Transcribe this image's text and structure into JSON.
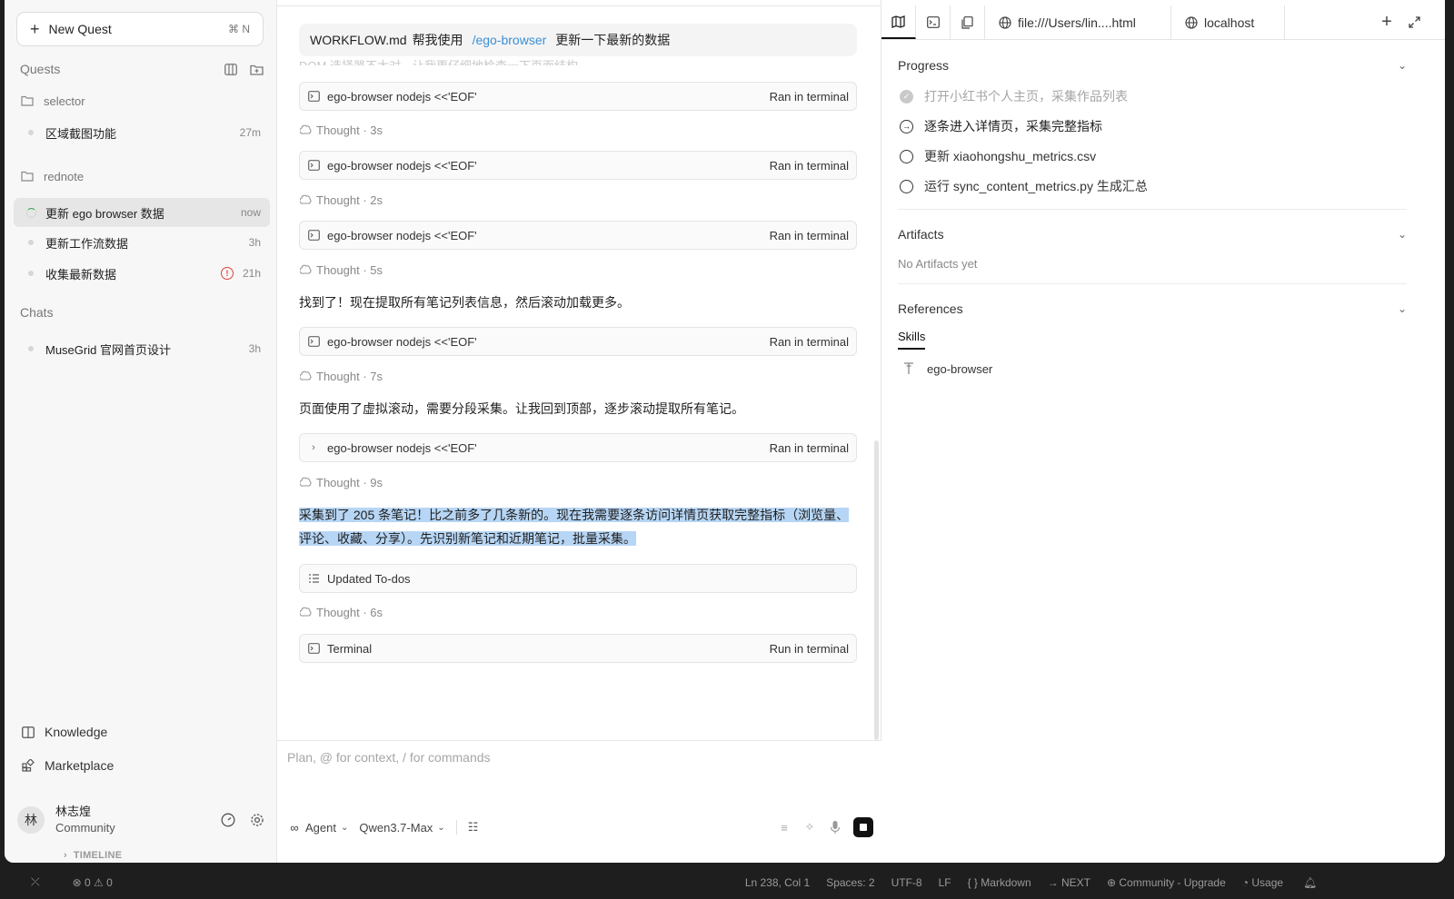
{
  "sidebar": {
    "new_quest_label": "New Quest",
    "new_quest_shortcut": "⌘ N",
    "quests_title": "Quests",
    "groups": [
      {
        "name": "selector"
      },
      {
        "name": "rednote"
      }
    ],
    "items": [
      {
        "label": "区域截图功能",
        "time": "27m"
      },
      {
        "label": "更新 ego browser 数据",
        "time": "now"
      },
      {
        "label": "更新工作流数据",
        "time": "3h"
      },
      {
        "label": "收集最新数据",
        "time": "21h"
      }
    ],
    "chats_title": "Chats",
    "chats": [
      {
        "label": "MuseGrid 官网首页设计",
        "time": "3h"
      }
    ],
    "knowledge_label": "Knowledge",
    "marketplace_label": "Marketplace",
    "user": {
      "avatar": "林",
      "name": "林志煌",
      "tier": "Community"
    }
  },
  "chat": {
    "prompt": {
      "file": "WORKFLOW.md",
      "pre": "帮我使用",
      "mention": "/ego-browser",
      "post": "更新一下最新的数据"
    },
    "faded_text": "DOM 选择器不太对，让我更仔细地检查一下页面结构。",
    "tool_cmd": "ego-browser nodejs <<'EOF'",
    "ran_label": "Ran in terminal",
    "thoughts": [
      "Thought · 3s",
      "Thought · 2s",
      "Thought · 5s",
      "Thought · 7s",
      "Thought · 9s",
      "Thought · 6s"
    ],
    "msg1": "找到了！现在提取所有笔记列表信息，然后滚动加载更多。",
    "msg2": "页面使用了虚拟滚动，需要分段采集。让我回到顶部，逐步滚动提取所有笔记。",
    "msg3_line1": "采集到了 205 条笔记！比之前多了几条新的。现在我需要逐条访问详情页获取完整指标（浏览量、",
    "msg3_line2": "评论、收藏、分享）。先识别新笔记和近期笔记，批量采集。",
    "updated_todos": "Updated To-dos",
    "terminal_label": "Terminal",
    "run_label": "Run in terminal",
    "input_placeholder": "Plan, @ for context, / for commands",
    "mode_label": "Agent",
    "model_label": "Qwen3.7-Max"
  },
  "panel": {
    "url_tab": "file:///Users/lin....html",
    "local_tab": "localhost",
    "progress_title": "Progress",
    "todos": [
      {
        "label": "打开小红书个人主页，采集作品列表",
        "state": "done"
      },
      {
        "label": "逐条进入详情页，采集完整指标",
        "state": "in-progress"
      },
      {
        "label": "更新 xiaohongshu_metrics.csv",
        "state": "pending"
      },
      {
        "label": "运行 sync_content_metrics.py 生成汇总",
        "state": "pending"
      }
    ],
    "artifacts_title": "Artifacts",
    "artifacts_empty": "No Artifacts yet",
    "references_title": "References",
    "skills_tab": "Skills",
    "skill_name": "ego-browser"
  },
  "statusbar": {
    "timeline": "TIMELINE",
    "errors": "0",
    "warnings": "0",
    "position": "Ln 238, Col 1",
    "spaces": "Spaces: 2",
    "encoding": "UTF-8",
    "eol": "LF",
    "language": "Markdown",
    "next": "NEXT",
    "community": "Community - Upgrade",
    "usage": "Usage"
  },
  "colors": {
    "accent_link": "#3b8fd6",
    "highlight": "#b7d6f5",
    "error": "#d9453c",
    "active_spinner": "#3aa35a"
  }
}
